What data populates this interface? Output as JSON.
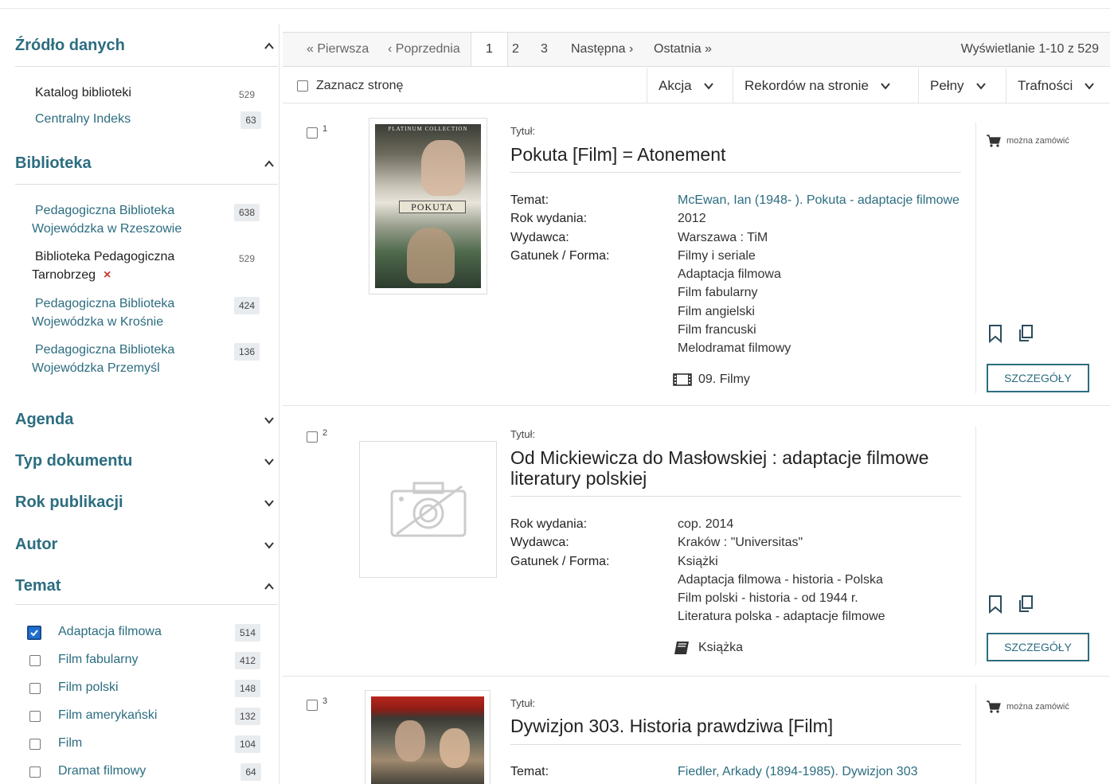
{
  "sidebar": {
    "source": {
      "title": "Źródło danych",
      "items": [
        {
          "label": "Katalog biblioteki",
          "count": "529"
        },
        {
          "label": "Centralny Indeks",
          "count": "63"
        }
      ]
    },
    "library": {
      "title": "Biblioteka",
      "items": [
        {
          "line1": "Pedagogiczna Biblioteka",
          "line2": "Wojewódzka w Rzeszowie",
          "count": "638"
        },
        {
          "line1": "Biblioteka Pedagogiczna",
          "line2": "Tarnobrzeg",
          "count": "529",
          "remove": "×"
        },
        {
          "line1": "Pedagogiczna Biblioteka",
          "line2": "Wojewódzka w Krośnie",
          "count": "424"
        },
        {
          "line1": "Pedagogiczna Biblioteka",
          "line2": "Wojewódzka Przemyśl",
          "count": "136"
        }
      ]
    },
    "collapsed": [
      "Agenda",
      "Typ dokumentu",
      "Rok publikacji",
      "Autor"
    ],
    "subject": {
      "title": "Temat",
      "items": [
        {
          "label": "Adaptacja filmowa",
          "count": "514",
          "checked": true
        },
        {
          "label": "Film fabularny",
          "count": "412"
        },
        {
          "label": "Film polski",
          "count": "148"
        },
        {
          "label": "Film amerykański",
          "count": "132"
        },
        {
          "label": "Film",
          "count": "104"
        },
        {
          "label": "Dramat filmowy",
          "count": "64"
        }
      ]
    }
  },
  "pager": {
    "first": "« Pierwsza",
    "prev": "‹ Poprzednia",
    "pages": [
      "1",
      "2",
      "3"
    ],
    "next": "Następna ›",
    "last": "Ostatnia »",
    "info": "Wyświetlanie 1-10 z 529"
  },
  "toolbar": {
    "select_page": "Zaznacz stronę",
    "action": "Akcja",
    "per_page": "Rekordów na stronie",
    "view": "Pełny",
    "sort": "Trafności"
  },
  "records": [
    {
      "num": "1",
      "title_label": "Tytuł:",
      "title": "Pokuta [Film] = Atonement",
      "cover_text": "POKUTA",
      "cover_top": "PLATINUM COLLECTION",
      "fields": [
        {
          "k": "Temat:",
          "v": "McEwan, Ian (1948- ). Pokuta - adaptacje filmowe",
          "link": true
        },
        {
          "k": "Rok wydania:",
          "v": "2012"
        },
        {
          "k": "Wydawca:",
          "v": "Warszawa : TiM"
        },
        {
          "k": "Gatunek / Forma:",
          "v": "Filmy i seriale"
        },
        {
          "k": "",
          "v": "Adaptacja filmowa"
        },
        {
          "k": "",
          "v": "Film fabularny"
        },
        {
          "k": "",
          "v": "Film angielski"
        },
        {
          "k": "",
          "v": "Film francuski"
        },
        {
          "k": "",
          "v": "Melodramat filmowy"
        }
      ],
      "format": "09. Filmy",
      "order": "można zamówić",
      "details": "SZCZEGÓŁY"
    },
    {
      "num": "2",
      "title_label": "Tytuł:",
      "title": "Od Mickiewicza do Masłowskiej : adaptacje filmowe literatury polskiej",
      "fields": [
        {
          "k": "Rok wydania:",
          "v": "cop. 2014"
        },
        {
          "k": "Wydawca:",
          "v": "Kraków : \"Universitas\""
        },
        {
          "k": "Gatunek / Forma:",
          "v": "Książki"
        },
        {
          "k": "",
          "v": "Adaptacja filmowa - historia - Polska"
        },
        {
          "k": "",
          "v": "Film polski - historia - od 1944 r."
        },
        {
          "k": "",
          "v": "Literatura polska - adaptacje filmowe"
        }
      ],
      "format": "Książka",
      "details": "SZCZEGÓŁY"
    },
    {
      "num": "3",
      "title_label": "Tytuł:",
      "title": "Dywizjon 303. Historia prawdziwa [Film]",
      "fields": [
        {
          "k": "Temat:",
          "v": "Fiedler, Arkady (1894-1985). Dywizjon 303",
          "link": true
        }
      ],
      "order": "można zamówić"
    }
  ]
}
